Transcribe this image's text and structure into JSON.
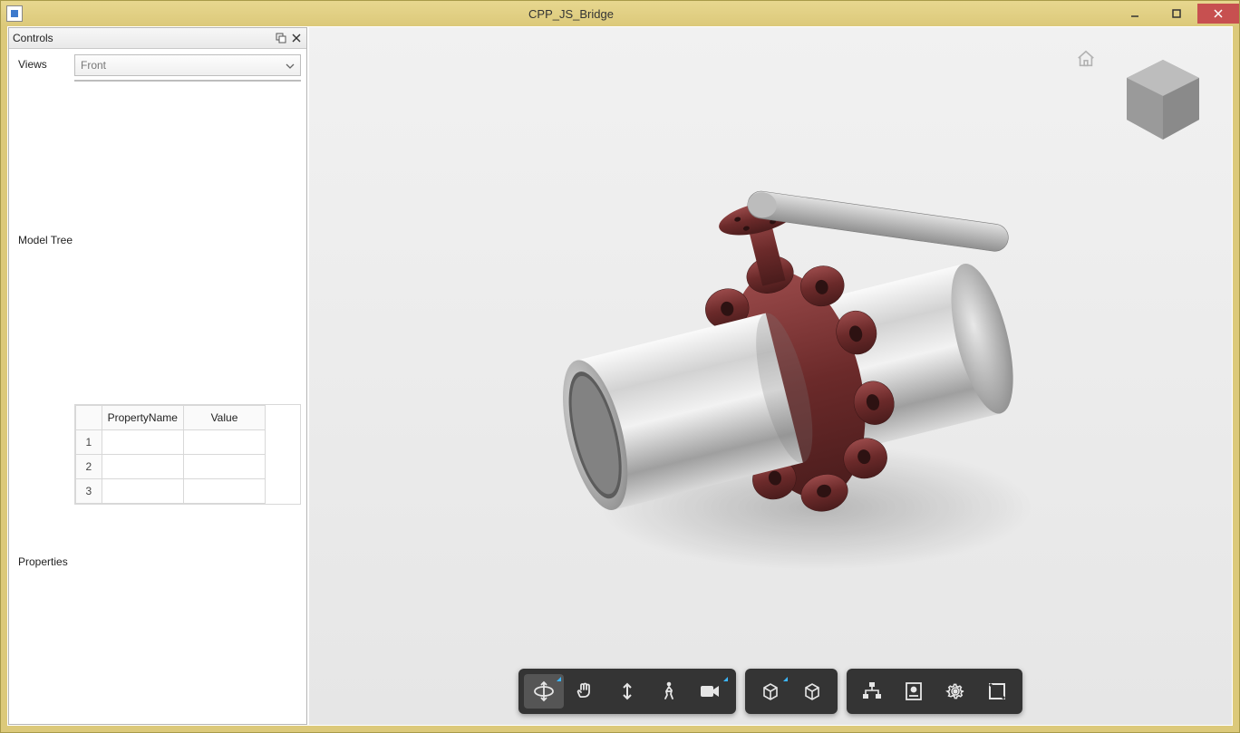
{
  "window": {
    "title": "CPP_JS_Bridge"
  },
  "controls": {
    "panel_title": "Controls",
    "views_label": "Views",
    "views_selected": "Front",
    "model_tree_label": "Model Tree",
    "properties_label": "Properties",
    "table": {
      "col_property": "PropertyName",
      "col_value": "Value",
      "rows": [
        {
          "idx": "1",
          "name": "",
          "value": ""
        },
        {
          "idx": "2",
          "name": "",
          "value": ""
        },
        {
          "idx": "3",
          "name": "",
          "value": ""
        }
      ]
    }
  },
  "toolbar": {
    "orbit": "orbit",
    "pan": "pan",
    "updown": "look-vertical",
    "walk": "walk",
    "camera": "camera",
    "box": "first-person",
    "cube": "wireframe",
    "hierarchy": "model-browser",
    "sheet": "properties",
    "settings": "settings",
    "fullscreen": "fullscreen"
  }
}
